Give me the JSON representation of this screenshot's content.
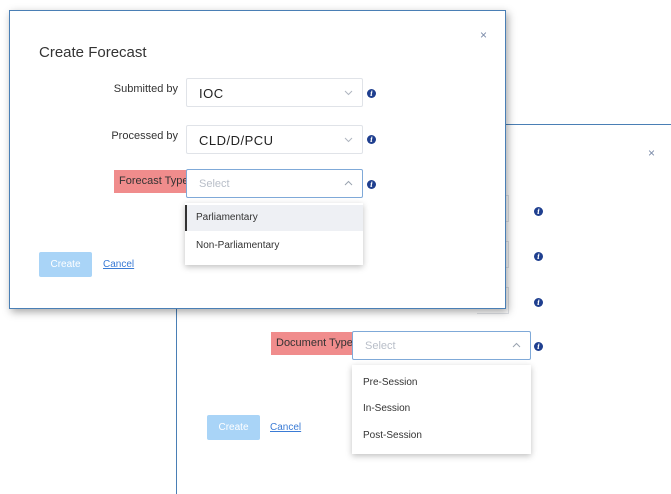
{
  "back_dialog": {
    "close_glyph": "×",
    "document_type_label": "Document Type",
    "document_type_placeholder": "Select",
    "options": [
      "Pre-Session",
      "In-Session",
      "Post-Session"
    ],
    "create_label": "Create",
    "cancel_label": "Cancel"
  },
  "front_dialog": {
    "title": "Create Forecast",
    "close_glyph": "×",
    "submitted_by_label": "Submitted by",
    "submitted_by_value": "IOC",
    "processed_by_label": "Processed by",
    "processed_by_value": "CLD/D/PCU",
    "forecast_type_label": "Forecast Type",
    "forecast_type_placeholder": "Select",
    "options": [
      "Parliamentary",
      "Non-Parliamentary"
    ],
    "create_label": "Create",
    "cancel_label": "Cancel",
    "info_glyph": "i"
  },
  "colors": {
    "accent": "#3a7bd5",
    "error_label_bg": "#f08c8c",
    "create_btn_bg": "#a9d4f7",
    "info_icon": "#1f3f8f"
  }
}
